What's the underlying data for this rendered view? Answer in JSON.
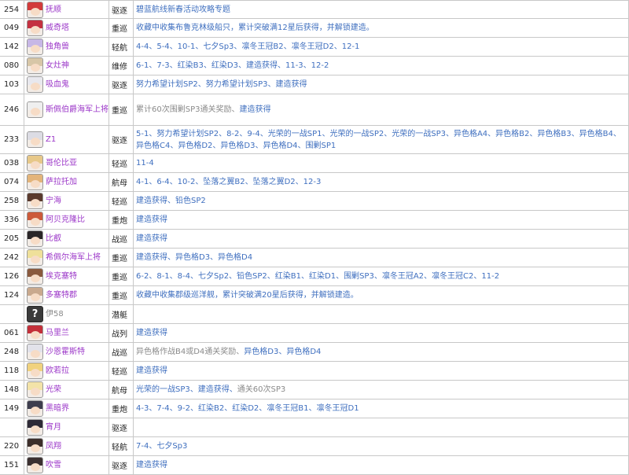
{
  "rows": [
    {
      "id": "254",
      "name": "抚顺",
      "type": "驱逐",
      "source": "碧蓝航线新春活动攻略专题",
      "avatar_icon": "shipgirl-avatar",
      "hair": "#d23a3a",
      "h": 24
    },
    {
      "id": "049",
      "name": "威奇塔",
      "type": "重巡",
      "source": "收藏中收集布鲁克林级船只，累计突破满12星后获得，并解锁建造。",
      "avatar_icon": "shipgirl-avatar",
      "hair": "#c43040",
      "h": 24
    },
    {
      "id": "142",
      "name": "独角兽",
      "type": "轻航",
      "source": "4-4、5-4、10-1、七夕Sp3、凛冬王冠B2、凛冬王冠D2、12-1",
      "avatar_icon": "shipgirl-avatar",
      "hair": "#c7b7e6",
      "h": 24
    },
    {
      "id": "080",
      "name": "女灶神",
      "type": "维修",
      "source": "6-1、7-3、红染B3、红染D3、建造获得、11-3、12-2",
      "avatar_icon": "shipgirl-avatar",
      "hair": "#d7c6a7",
      "h": 24
    },
    {
      "id": "103",
      "name": "吸血鬼",
      "type": "驱逐",
      "source": "努力希望计划SP2、努力希望计划SP3、建造获得",
      "avatar_icon": "shipgirl-avatar",
      "hair": "#e8e8ee",
      "h": 24
    },
    {
      "id": "246",
      "name": "斯佩伯爵海军上将",
      "type": "重巡",
      "source": "累计60次围剿SP3通关奖励、建造获得",
      "source_gray_prefix": "累计60次围剿SP3通关奖励、",
      "source_link": "建造获得",
      "avatar_icon": "shipgirl-avatar",
      "hair": "#efefef",
      "h": 40
    },
    {
      "id": "233",
      "name": "Z1",
      "type": "驱逐",
      "source": "5-1、努力希望计划SP2、8-2、9-4、光荣的一战SP1、光荣的一战SP2、光荣的一战SP3、异色格A4、异色格B2、异色格B3、异色格B4、异色格C4、异色格D2、异色格D3、异色格D4、围剿SP1",
      "avatar_icon": "shipgirl-avatar",
      "hair": "#dcdce4",
      "h": 36
    },
    {
      "id": "038",
      "name": "哥伦比亚",
      "type": "轻巡",
      "source": "11-4",
      "avatar_icon": "shipgirl-avatar",
      "hair": "#e7c889",
      "h": 24
    },
    {
      "id": "074",
      "name": "萨拉托加",
      "type": "航母",
      "source": "4-1、6-4、10-2、坠落之翼B2、坠落之翼D2、12-3",
      "avatar_icon": "shipgirl-avatar",
      "hair": "#e3b47a",
      "h": 24
    },
    {
      "id": "258",
      "name": "宁海",
      "type": "轻巡",
      "source": "建造获得、铅色SP2",
      "avatar_icon": "shipgirl-avatar",
      "hair": "#5a3a2e",
      "h": 24
    },
    {
      "id": "336",
      "name": "阿贝克隆比",
      "type": "重炮",
      "source": "建造获得",
      "avatar_icon": "shipgirl-avatar",
      "hair": "#cc5a3a",
      "h": 24
    },
    {
      "id": "205",
      "name": "比叡",
      "type": "战巡",
      "source": "建造获得",
      "avatar_icon": "shipgirl-avatar",
      "hair": "#2a2628",
      "h": 24
    },
    {
      "id": "242",
      "name": "希佩尔海军上将",
      "type": "重巡",
      "source": "建造获得、异色格D3、异色格D4",
      "avatar_icon": "shipgirl-avatar",
      "hair": "#efe09a",
      "h": 24
    },
    {
      "id": "126",
      "name": "埃克塞特",
      "type": "重巡",
      "source": "6-2、8-1、8-4、七夕Sp2、铅色SP2、红染B1、红染D1、围剿SP3、凛冬王冠A2、凛冬王冠C2、11-2",
      "avatar_icon": "shipgirl-avatar",
      "hair": "#8a5a3e",
      "h": 24
    },
    {
      "id": "124",
      "name": "多塞特郡",
      "type": "重巡",
      "source": "收藏中收集郡级巡洋舰，累计突破满20星后获得，并解锁建造。",
      "avatar_icon": "shipgirl-avatar",
      "hair": "#c9a98e",
      "h": 24
    },
    {
      "id": "",
      "name": "伊58",
      "type": "潜艇",
      "source": "",
      "avatar_icon": "unknown-avatar",
      "unknown_glyph": "?",
      "name_gray": true,
      "hair": "#3a3a3a",
      "h": 24
    },
    {
      "id": "061",
      "name": "马里兰",
      "type": "战列",
      "source": "建造获得",
      "avatar_icon": "shipgirl-avatar",
      "hair": "#c3303a",
      "h": 24
    },
    {
      "id": "248",
      "name": "沙恩霍斯特",
      "type": "战巡",
      "source": "异色格作战B4或D4通关奖励、异色格D3、异色格D4",
      "source_gray_prefix": "异色格作战B4或D4通关奖励、",
      "source_link": "异色格D3、异色格D4",
      "avatar_icon": "shipgirl-avatar",
      "hair": "#e2e2ea",
      "h": 24
    },
    {
      "id": "118",
      "name": "欧若拉",
      "type": "轻巡",
      "source": "建造获得",
      "avatar_icon": "shipgirl-avatar",
      "hair": "#f0d27e",
      "h": 24
    },
    {
      "id": "148",
      "name": "光荣",
      "type": "航母",
      "source": "光荣的一战SP3、建造获得、通关60次SP3",
      "source_gray_suffix": "通关60次SP3",
      "source_link": "光荣的一战SP3、建造获得、",
      "avatar_icon": "shipgirl-avatar",
      "hair": "#f3e3a8",
      "h": 24
    },
    {
      "id": "149",
      "name": "黑暗界",
      "type": "重炮",
      "source": "4-3、7-4、9-2、红染B2、红染D2、凛冬王冠B1、凛冬王冠D1",
      "avatar_icon": "shipgirl-avatar",
      "hair": "#3e3e4e",
      "h": 24
    },
    {
      "id": "",
      "name": "宵月",
      "type": "驱逐",
      "source": "",
      "avatar_icon": "shipgirl-avatar",
      "hair": "#2e2a36",
      "h": 24
    },
    {
      "id": "220",
      "name": "凤翔",
      "type": "轻航",
      "source": "7-4、七夕Sp3",
      "avatar_icon": "shipgirl-avatar",
      "hair": "#3c2e2a",
      "h": 24
    },
    {
      "id": "151",
      "name": "吹雪",
      "type": "驱逐",
      "source": "建造获得",
      "avatar_icon": "shipgirl-avatar",
      "hair": "#3b3030",
      "h": 24
    }
  ]
}
